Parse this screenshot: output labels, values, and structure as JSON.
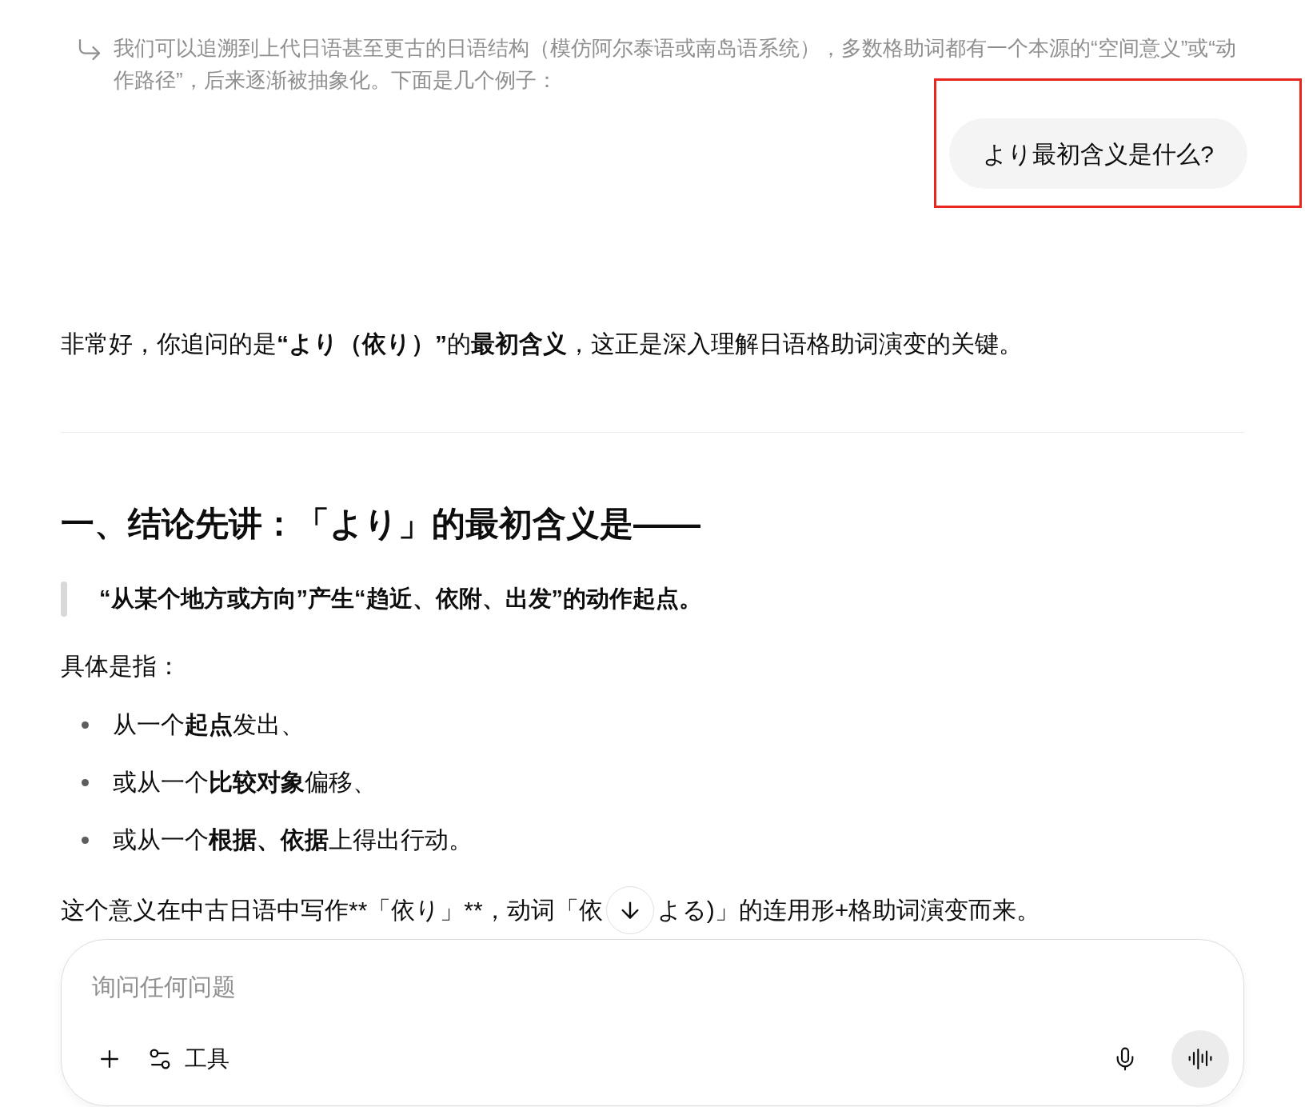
{
  "context_quote": {
    "text": "我们可以追溯到上代日语甚至更古的日语结构（模仿阿尔泰语或南岛语系统），多数格助词都有一个本源的“空间意义”或“动作路径”，后来逐渐被抽象化。下面是几个例子："
  },
  "user_message": {
    "text": "より最初含义是什么?",
    "highlighted": true
  },
  "response": {
    "intro": "非常好，你追问的是**“より（依り）”**的**最初含义**，这正是深入理解日语格助词演变的关键。",
    "heading": "一、结论先讲：「より」的最初含义是——",
    "blockquote": "“从某个地方或方向”产生“趋近、依附、出发”的动作起点。",
    "lead": "具体是指：",
    "bullets": [
      "从一个**起点**发出、",
      "或从一个**比较对象**偏移、",
      "或从一个**根据、依据**上得出行动。"
    ],
    "closing_before": "这个意义在中古日语中写作**「依り」**，动词「依",
    "closing_after": "よる)」的连用形+格助词演变而来。"
  },
  "composer": {
    "placeholder": "询问任何问题",
    "tools_label": "工具"
  }
}
